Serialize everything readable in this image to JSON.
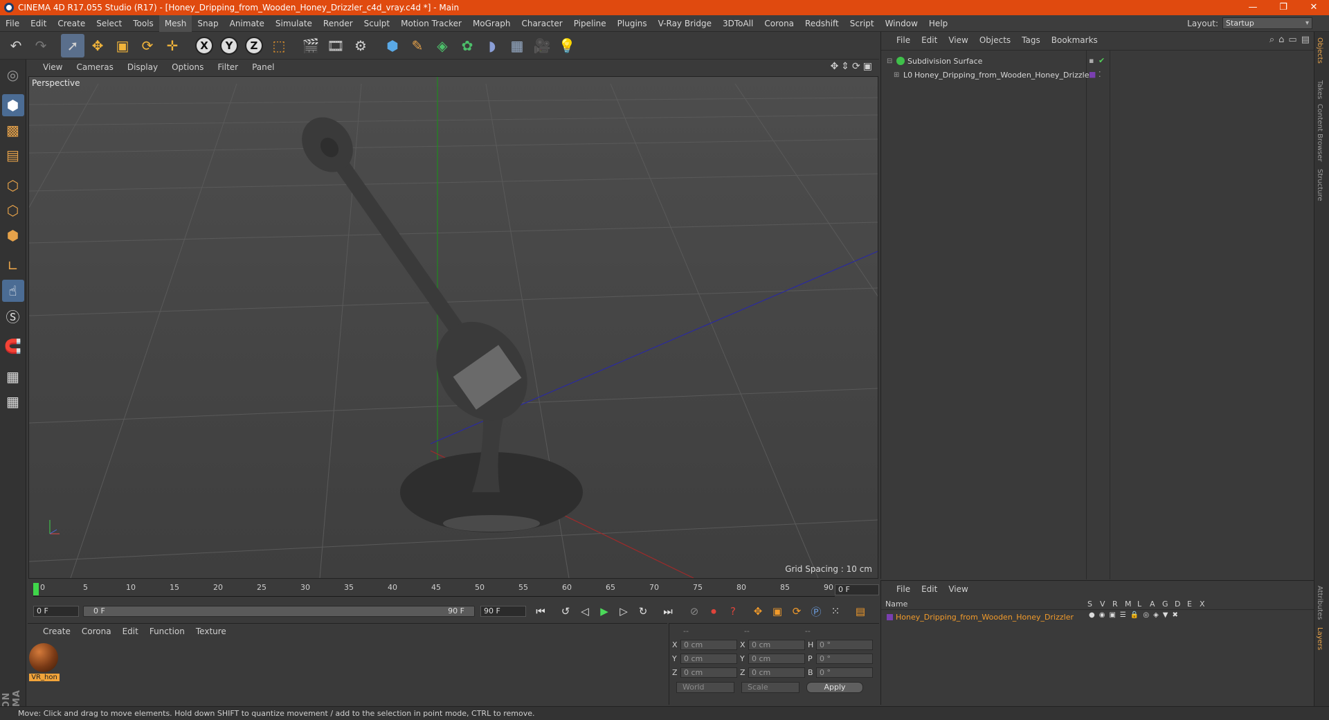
{
  "window": {
    "title": "CINEMA 4D R17.055 Studio (R17) - [Honey_Dripping_from_Wooden_Honey_Drizzler_c4d_vray.c4d *] - Main",
    "controls": [
      "—",
      "❐",
      "✕"
    ]
  },
  "menubar": {
    "items": [
      "File",
      "Edit",
      "Create",
      "Select",
      "Tools",
      "Mesh",
      "Snap",
      "Animate",
      "Simulate",
      "Render",
      "Sculpt",
      "Motion Tracker",
      "MoGraph",
      "Character",
      "Pipeline",
      "Plugins",
      "V-Ray Bridge",
      "3DToAll",
      "Corona",
      "Redshift",
      "Script",
      "Window",
      "Help"
    ],
    "active": "Mesh",
    "layout_label": "Layout:",
    "layout_value": "Startup"
  },
  "viewport": {
    "menu": [
      "View",
      "Cameras",
      "Display",
      "Options",
      "Filter",
      "Panel"
    ],
    "label": "Perspective",
    "grid_spacing": "Grid Spacing : 10 cm"
  },
  "timeline": {
    "ticks": [
      "0",
      "5",
      "10",
      "15",
      "20",
      "25",
      "30",
      "35",
      "40",
      "45",
      "50",
      "55",
      "60",
      "65",
      "70",
      "75",
      "80",
      "85",
      "90"
    ],
    "current_frame": "0 F",
    "start_field": "0 F",
    "slider_start": "0 F",
    "slider_end": "90 F",
    "end_field": "90 F"
  },
  "material_manager": {
    "menu": [
      "Create",
      "Corona",
      "Edit",
      "Function",
      "Texture"
    ],
    "materials": [
      {
        "name": "VR_hon"
      }
    ]
  },
  "coordinates": {
    "headers": [
      "--",
      "--",
      "--"
    ],
    "rows": [
      {
        "a": "X",
        "v1": "0 cm",
        "b": "X",
        "v2": "0 cm",
        "c": "H",
        "v3": "0 °"
      },
      {
        "a": "Y",
        "v1": "0 cm",
        "b": "Y",
        "v2": "0 cm",
        "c": "P",
        "v3": "0 °"
      },
      {
        "a": "Z",
        "v1": "0 cm",
        "b": "Z",
        "v2": "0 cm",
        "c": "B",
        "v3": "0 °"
      }
    ],
    "mode": "World",
    "scale": "Scale",
    "apply": "Apply"
  },
  "object_manager": {
    "menu": [
      "File",
      "Edit",
      "View",
      "Objects",
      "Tags",
      "Bookmarks"
    ],
    "objects": [
      {
        "name": "Subdivision Surface"
      },
      {
        "name": "Honey_Dripping_from_Wooden_Honey_Drizzler"
      }
    ]
  },
  "side_tabs": [
    "Objects",
    "Takes",
    "Content Browser",
    "Structure"
  ],
  "side_tabs_bottom": [
    "Attributes",
    "Layers"
  ],
  "layer_manager": {
    "menu": [
      "File",
      "Edit",
      "View"
    ],
    "columns": [
      "Name",
      "S",
      "V",
      "R",
      "M",
      "L",
      "A",
      "G",
      "D",
      "E",
      "X"
    ],
    "layers": [
      {
        "name": "Honey_Dripping_from_Wooden_Honey_Drizzler",
        "color": "#7a3fb0"
      }
    ]
  },
  "status": {
    "text": "Move: Click and drag to move elements. Hold down SHIFT to quantize movement / add to the selection in point mode, CTRL to remove."
  },
  "colors": {
    "accent": "#e04a0f",
    "selection": "#5a6f8c",
    "play_green": "#4cd95a",
    "layer_text": "#f29b2b"
  }
}
